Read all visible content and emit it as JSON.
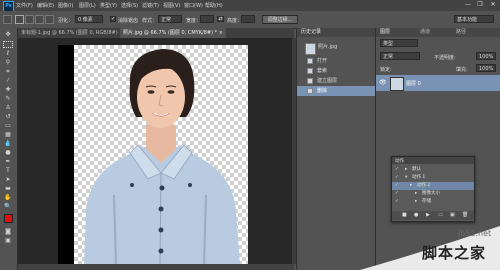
{
  "app": {
    "logo": "Ps"
  },
  "menu": [
    "文件(F)",
    "编辑(E)",
    "图像(I)",
    "图层(L)",
    "类型(Y)",
    "选择(S)",
    "滤镜(T)",
    "视图(V)",
    "窗口(W)",
    "帮助(H)"
  ],
  "window_controls": {
    "minimize": "—",
    "restore": "❐",
    "close": "✕"
  },
  "options": {
    "feather_label": "羽化：",
    "feather_value": "0 像素",
    "antialias_label": "消除锯齿",
    "style_label": "样式：",
    "style_value": "正常",
    "width_label": "宽度：",
    "height_label": "高度：",
    "refine_edge": "调整边缘...",
    "workspace": "基本功能"
  },
  "tabs": [
    {
      "label": "未标题-1.jpg @ 66.7% (图层 0, RGB/8#) ×"
    },
    {
      "label": "照片.jpg @ 66.7% (图层 0, CMYK/8#) * ×"
    }
  ],
  "history": {
    "title": "历史记录",
    "doc": "照片.jpg",
    "items": [
      "打开",
      "套索",
      "建立图层",
      "删除"
    ],
    "selected_index": 3
  },
  "layers": {
    "tabs": [
      "图层",
      "通道",
      "路径"
    ],
    "kind_label": "类型",
    "mode_label": "正常",
    "opacity_label": "不透明度:",
    "opacity_value": "100%",
    "lock_label": "锁定:",
    "fill_label": "填充:",
    "fill_value": "100%",
    "layer_name": "图层 0"
  },
  "actions": {
    "title": "动作",
    "items": [
      "默认",
      "动作 1",
      "动作 2",
      "图像大小",
      "存储"
    ],
    "selected_index": 2
  },
  "watermark": {
    "url": "jb51.net",
    "name": "脚本之家"
  },
  "colors": {
    "foreground": "#e01010",
    "background": "#ffffff",
    "accent": "#31a8ff"
  }
}
